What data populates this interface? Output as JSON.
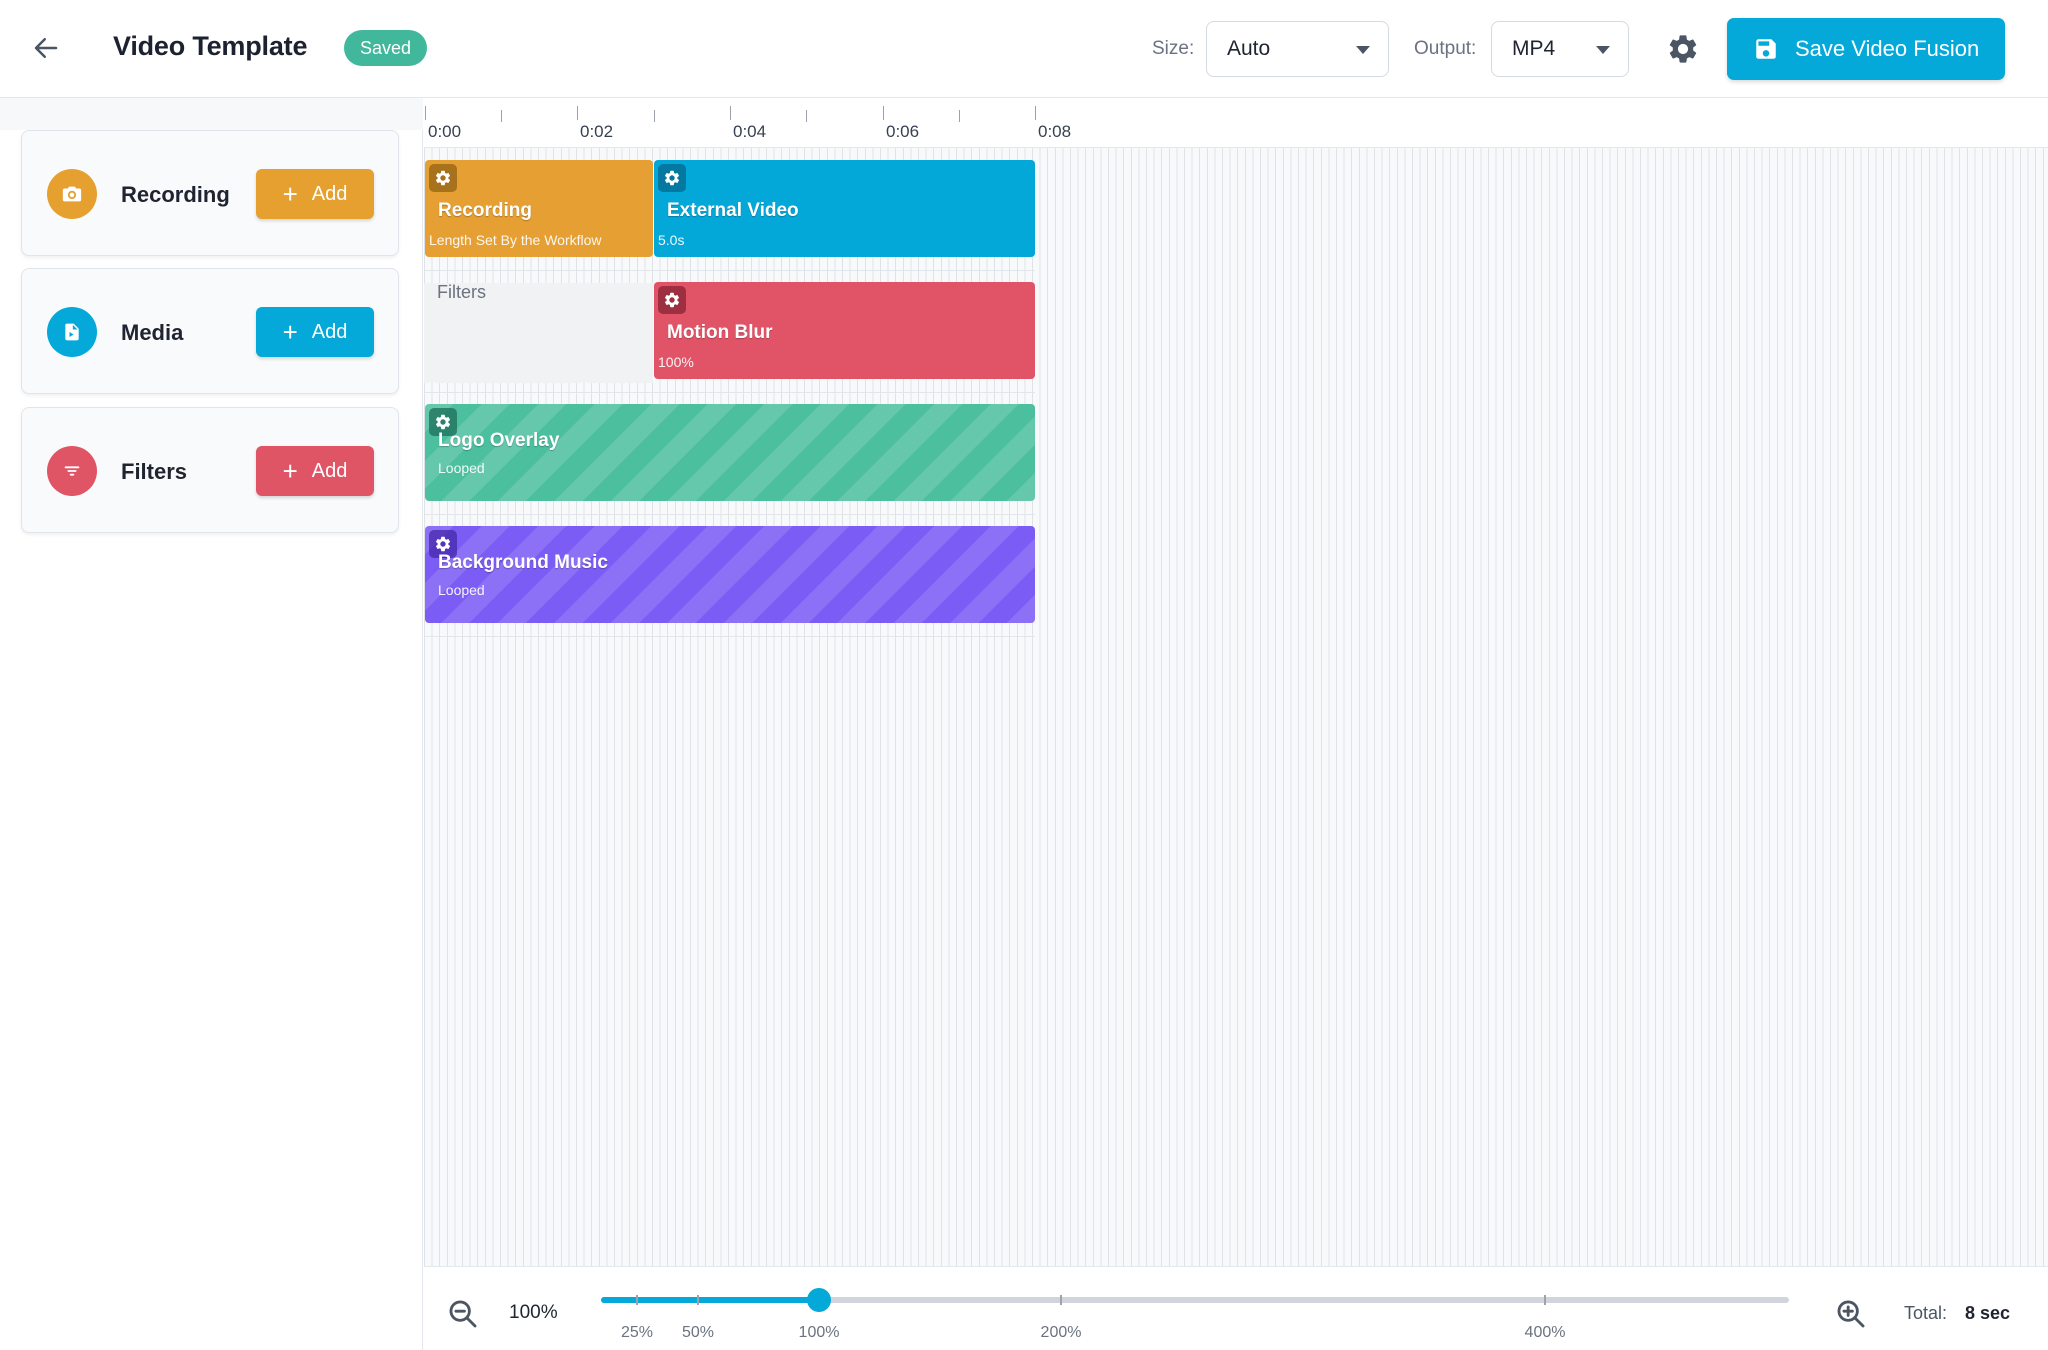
{
  "header": {
    "title": "Video Template",
    "status_badge": "Saved",
    "size_label": "Size:",
    "size_value": "Auto",
    "output_label": "Output:",
    "output_value": "MP4",
    "save_button": "Save Video Fusion",
    "icons": [
      "arrow-left-icon",
      "gear-icon",
      "floppy-disk-icon"
    ]
  },
  "sidebar": {
    "cards": [
      {
        "label": "Recording",
        "add_label": "Add",
        "color": "#e5a030",
        "icon": "camera-icon"
      },
      {
        "label": "Media",
        "add_label": "Add",
        "color": "#04a8d9",
        "icon": "document-icon"
      },
      {
        "label": "Filters",
        "add_label": "Add",
        "color": "#e05565",
        "icon": "filter-icon"
      }
    ]
  },
  "timeline": {
    "ruler_labels": [
      "0:00",
      "0:02",
      "0:04",
      "0:06",
      "0:08"
    ],
    "filters_track_label": "Filters",
    "clips": [
      {
        "title": "Recording",
        "subtitle": "Length Set By the Workflow",
        "color": "#e59f32"
      },
      {
        "title": "External Video",
        "subtitle": "5.0s",
        "color": "#03a8d8"
      },
      {
        "title": "Motion Blur",
        "subtitle": "100%",
        "color": "#e15468"
      },
      {
        "title": "Logo Overlay",
        "subtitle": "Looped",
        "color": "#4cbf9f"
      },
      {
        "title": "Background Music",
        "subtitle": "Looped",
        "color": "#7b5cf5"
      }
    ]
  },
  "zoom": {
    "value_text": "100%",
    "value_percent": 100,
    "marks": [
      "25%",
      "50%",
      "100%",
      "200%",
      "400%"
    ],
    "total_label": "Total:",
    "total_value": "8 sec"
  }
}
